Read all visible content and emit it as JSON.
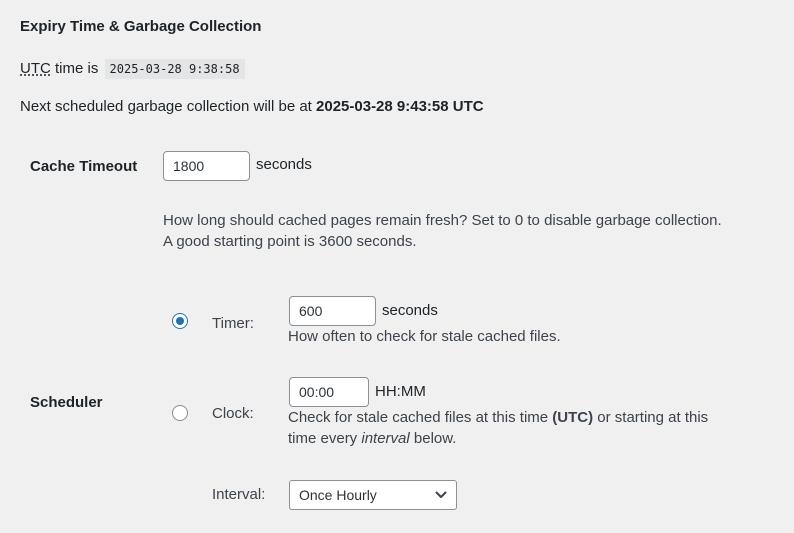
{
  "section": {
    "title": "Expiry Time & Garbage Collection"
  },
  "utc": {
    "abbr": "UTC",
    "prefix_rest": " time is",
    "value": "2025-03-28 9:38:58"
  },
  "next_gc": {
    "text": "Next scheduled garbage collection will be at ",
    "value": "2025-03-28 9:43:58 UTC"
  },
  "cache_timeout": {
    "label": "Cache Timeout",
    "value": "1800",
    "unit": "seconds",
    "description_line1": "How long should cached pages remain fresh? Set to 0 to disable garbage collection.",
    "description_line2": "A good starting point is 3600 seconds."
  },
  "scheduler": {
    "label": "Scheduler",
    "selected": "timer",
    "timer": {
      "label": "Timer:",
      "value": "600",
      "unit": "seconds",
      "description": "How often to check for stale cached files."
    },
    "clock": {
      "label": "Clock:",
      "value": "00:00",
      "unit": "HH:MM",
      "description_pre": "Check for stale cached files at this time ",
      "description_bold": "(UTC)",
      "description_post": " or starting at this",
      "description_line2_pre": "time every ",
      "description_line2_italic": "interval",
      "description_line2_post": " below."
    },
    "interval": {
      "label": "Interval:",
      "selected": "Once Hourly"
    }
  },
  "icons": {
    "select_arrow": "chevron-down-icon"
  },
  "colors": {
    "accent": "#2271b1",
    "background": "#f0f0f1"
  }
}
